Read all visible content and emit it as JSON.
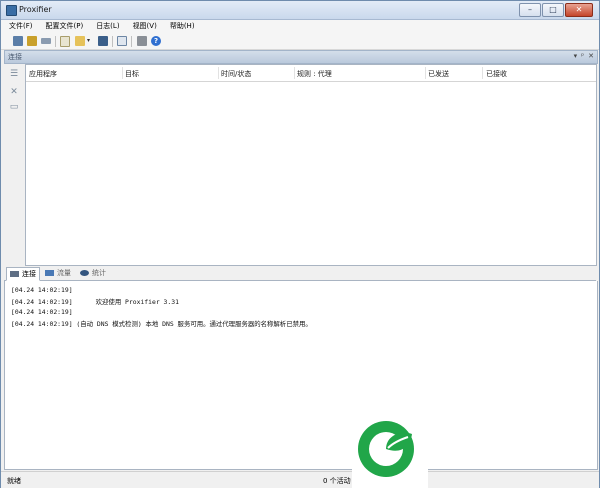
{
  "window": {
    "title": "Proxifier"
  },
  "title_buttons": {
    "minimize": "–",
    "maximize": "□",
    "close": "✕"
  },
  "menu": [
    {
      "label": "文件(F)"
    },
    {
      "label": "配置文件(P)"
    },
    {
      "label": "日志(L)"
    },
    {
      "label": "视图(V)"
    },
    {
      "label": "帮助(H)"
    }
  ],
  "toolbar_icons": [
    "connections-icon",
    "profile-icon",
    "rules-icon",
    "new-file-icon",
    "open-folder-icon",
    "dropdown-icon",
    "save-icon",
    "copy-icon",
    "print-icon",
    "help-icon"
  ],
  "connections_panel": {
    "title": "连接",
    "controls": {
      "menu": "▾",
      "pin": "ᵖ",
      "close": "✕"
    },
    "columns": [
      "应用程序",
      "目标",
      "时间/状态",
      "规则 : 代理",
      "已发送",
      "已接收"
    ]
  },
  "tabs": [
    {
      "label": "连接"
    },
    {
      "label": "流量"
    },
    {
      "label": "统计"
    }
  ],
  "log_lines": [
    {
      "text": "[04.24 14:02:19]"
    },
    {
      "text": "[04.24 14:02:19]      欢迎使用 Proxifier 3.31"
    },
    {
      "text": "[04.24 14:02:19]"
    },
    {
      "text": "[04.24 14:02:19] (自动 DNS 模式检测) 本地 DNS 服务可用。通过代理服务器的名称解析已禁用。"
    }
  ],
  "status": {
    "left": "就绪",
    "right": "0 个活动"
  },
  "colors": {
    "accent": "#3a6ea5",
    "logo_green": "#21a649"
  }
}
